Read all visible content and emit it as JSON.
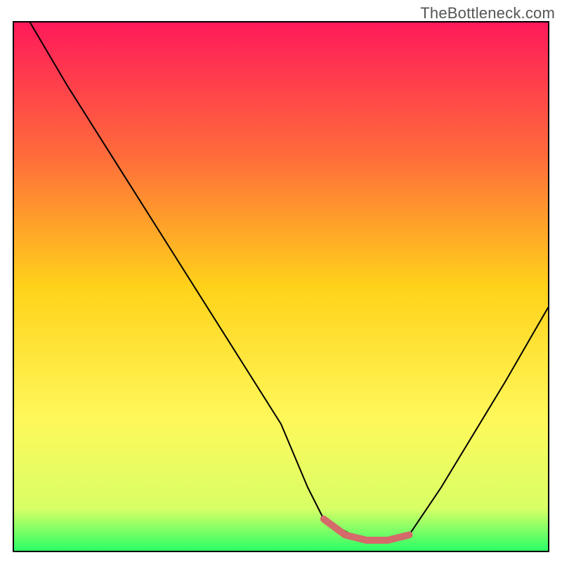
{
  "watermark": "TheBottleneck.com",
  "chart_data": {
    "type": "line",
    "title": "",
    "xlabel": "",
    "ylabel": "",
    "xlim": [
      0,
      100
    ],
    "ylim": [
      0,
      100
    ],
    "x": [
      3,
      10,
      20,
      30,
      40,
      50,
      55,
      58,
      65,
      70,
      74,
      80,
      86,
      92,
      100
    ],
    "series": [
      {
        "name": "bottleneck-curve",
        "values": [
          100,
          88,
          72,
          56,
          40,
          24,
          12,
          6,
          2,
          2,
          3,
          12,
          22,
          32,
          46
        ]
      }
    ],
    "highlight": {
      "x": [
        58,
        62,
        66,
        70,
        74
      ],
      "values": [
        6,
        3,
        2,
        2,
        3
      ]
    },
    "gradient_stops": [
      {
        "offset": 0.0,
        "color": "#ff1a5a"
      },
      {
        "offset": 0.25,
        "color": "#ff6b3b"
      },
      {
        "offset": 0.5,
        "color": "#ffd21a"
      },
      {
        "offset": 0.75,
        "color": "#fff85a"
      },
      {
        "offset": 0.92,
        "color": "#d8ff66"
      },
      {
        "offset": 1.0,
        "color": "#2bff66"
      }
    ]
  }
}
